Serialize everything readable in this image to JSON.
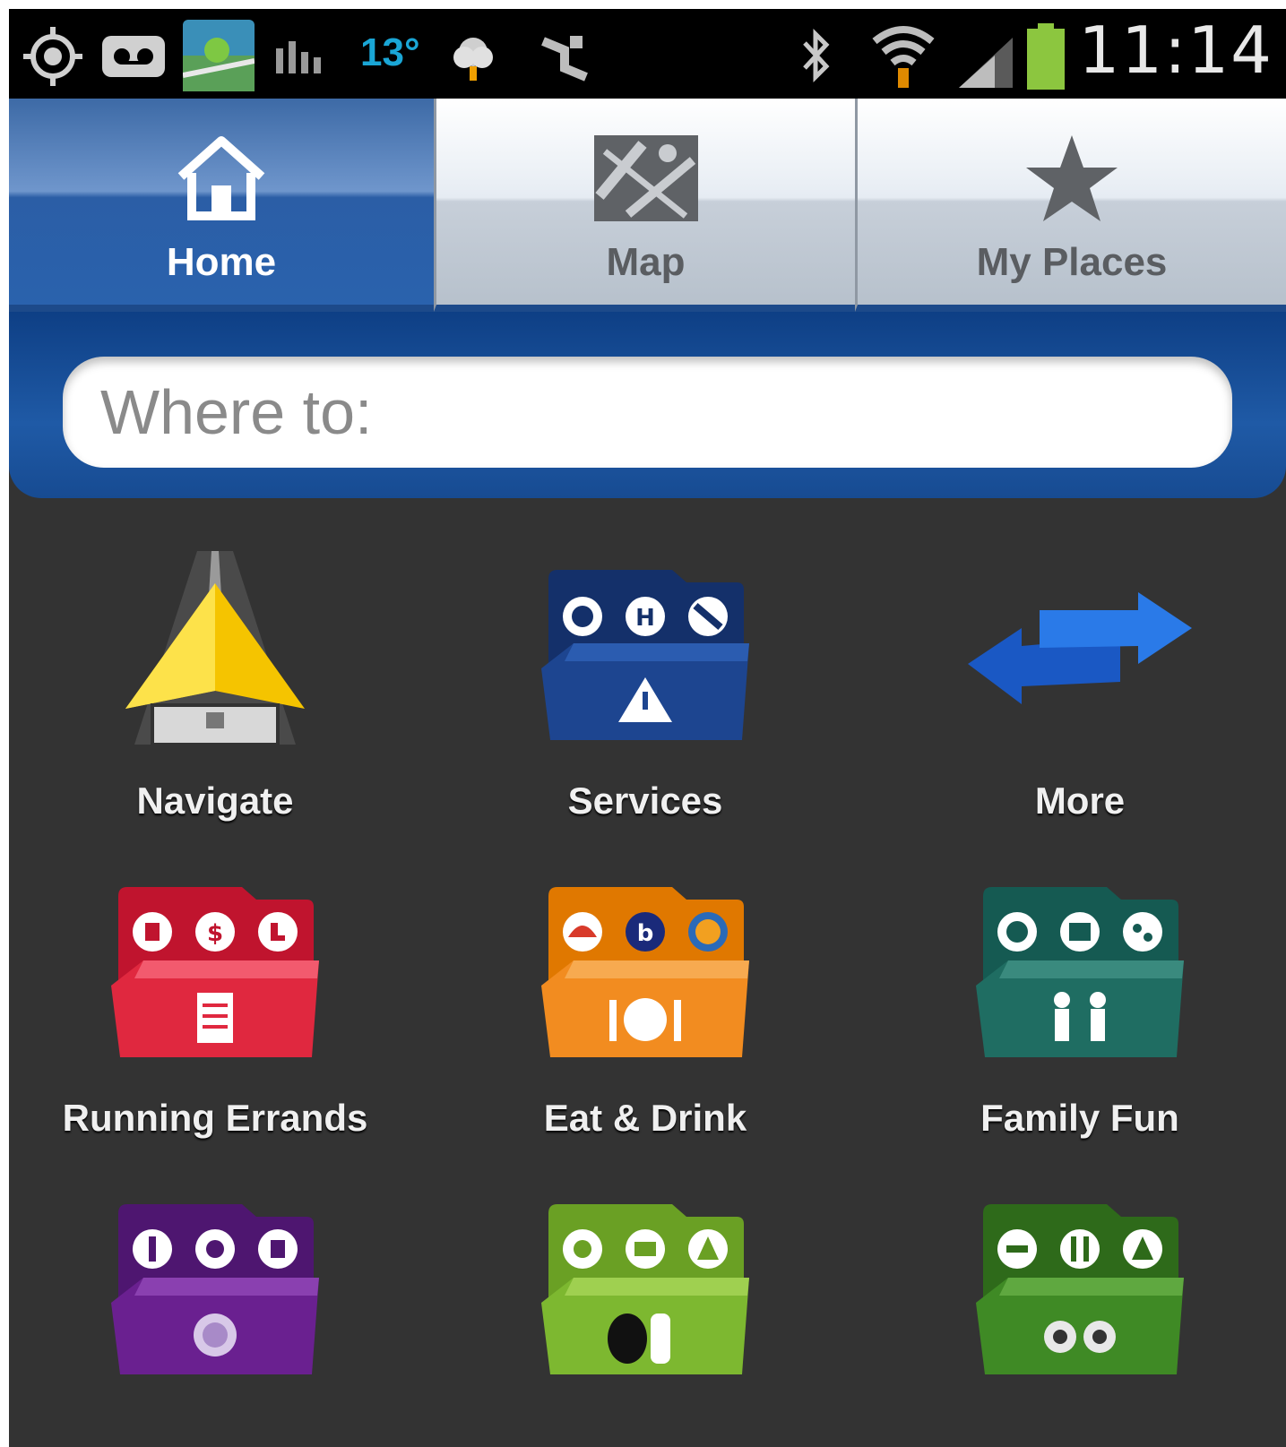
{
  "status_bar": {
    "temperature": "13°",
    "time": "11:14",
    "icons": [
      "gps-icon",
      "voicemail-icon",
      "map-app-icon",
      "signal-stats-icon",
      "weather-icon",
      "usb-icon",
      "bluetooth-icon",
      "wifi-icon",
      "cell-signal-icon",
      "battery-icon"
    ],
    "battery_color": "#8cc63f"
  },
  "tabs": [
    {
      "label": "Home",
      "icon": "home-icon",
      "active": true
    },
    {
      "label": "Map",
      "icon": "map-icon",
      "active": false
    },
    {
      "label": "My Places",
      "icon": "star-icon",
      "active": false
    }
  ],
  "search": {
    "placeholder": "Where to:"
  },
  "grid": [
    {
      "label": "Navigate",
      "icon": "navigate-arrow-icon",
      "color": "#f2c400"
    },
    {
      "label": "Services",
      "icon": "services-folder-icon",
      "color": "#1a3a7a"
    },
    {
      "label": "More",
      "icon": "more-arrows-icon",
      "color": "#1f66d1"
    },
    {
      "label": "Running Errands",
      "icon": "running-errands-folder-icon",
      "color": "#d81f3a"
    },
    {
      "label": "Eat & Drink",
      "icon": "eat-drink-folder-icon",
      "color": "#f08a1c"
    },
    {
      "label": "Family Fun",
      "icon": "family-fun-folder-icon",
      "color": "#1f6d62"
    },
    {
      "label": "",
      "icon": "purple-folder-icon",
      "color": "#6a2090"
    },
    {
      "label": "",
      "icon": "eo-folder-icon",
      "color": "#7db830"
    },
    {
      "label": "",
      "icon": "tripadvisor-folder-icon",
      "color": "#3f8a25"
    }
  ]
}
